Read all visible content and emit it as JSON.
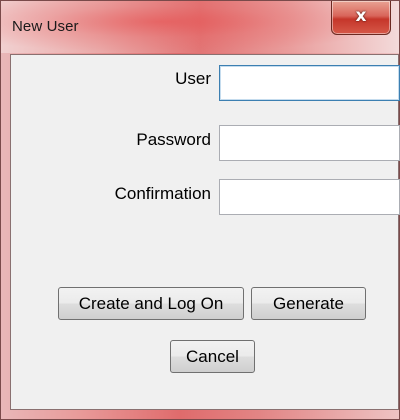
{
  "window": {
    "title": "New User",
    "close_glyph": "x",
    "close_icon": "close-icon"
  },
  "form": {
    "fields": [
      {
        "label": "User",
        "value": "",
        "focused": true
      },
      {
        "label": "Password",
        "value": "",
        "focused": false
      },
      {
        "label": "Confirmation",
        "value": "",
        "focused": false
      }
    ]
  },
  "buttons": {
    "create_and_log_on": "Create and Log On",
    "generate": "Generate",
    "cancel": "Cancel"
  },
  "colors": {
    "frame_accent": "#e06b6c",
    "close_button": "#c5362a",
    "dialog_background": "#f0f0f0",
    "focus_border": "#3c7fb1"
  }
}
